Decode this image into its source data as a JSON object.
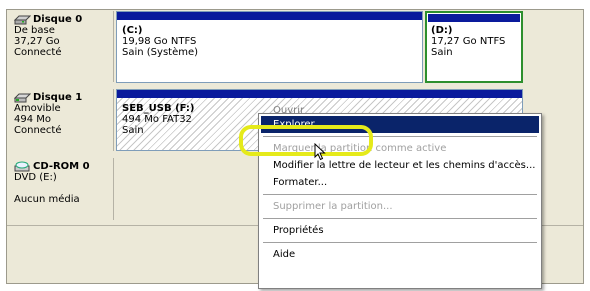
{
  "disks": [
    {
      "title": "Disque 0",
      "lines": [
        "De base",
        "37,27 Go",
        "Connecté"
      ],
      "icon": "hard-disk-icon",
      "partitions": [
        {
          "name": "(C:)",
          "lines": [
            "19,98 Go NTFS",
            "Sain (Système)"
          ]
        },
        {
          "name": "(D:)",
          "lines": [
            "17,27 Go NTFS",
            "Sain"
          ]
        }
      ]
    },
    {
      "title": "Disque 1",
      "lines": [
        "Amovible",
        "494 Mo",
        "Connecté"
      ],
      "icon": "removable-disk-icon",
      "partitions": [
        {
          "name": "SEB_USB  (F:)",
          "lines": [
            "494 Mo FAT32",
            "Sain"
          ],
          "behind_menu_text": "Ouvrir"
        }
      ]
    },
    {
      "title": "CD-ROM 0",
      "lines": [
        "DVD (E:)",
        "",
        "Aucun média"
      ],
      "icon": "cdrom-icon"
    }
  ],
  "context_menu": {
    "items": [
      {
        "label": "Explorer",
        "state": "highlighted"
      },
      {
        "separator": true
      },
      {
        "label": "Marquer la partition comme active",
        "state": "disabled"
      },
      {
        "label": "Modifier la lettre de lecteur et les chemins d'accès...",
        "state": "enabled"
      },
      {
        "label": "Formater...",
        "state": "enabled"
      },
      {
        "separator": true
      },
      {
        "label": "Supprimer la partition...",
        "state": "disabled"
      },
      {
        "separator": true
      },
      {
        "label": "Propriétés",
        "state": "enabled"
      },
      {
        "separator": true
      },
      {
        "label": "Aide",
        "state": "enabled"
      }
    ]
  },
  "colors": {
    "partition_bar": "#0a1a9c",
    "selection_outline": "#2d8f2d",
    "menu_highlight": "#0a246a",
    "annotation_ring": "#e5ea1a"
  }
}
